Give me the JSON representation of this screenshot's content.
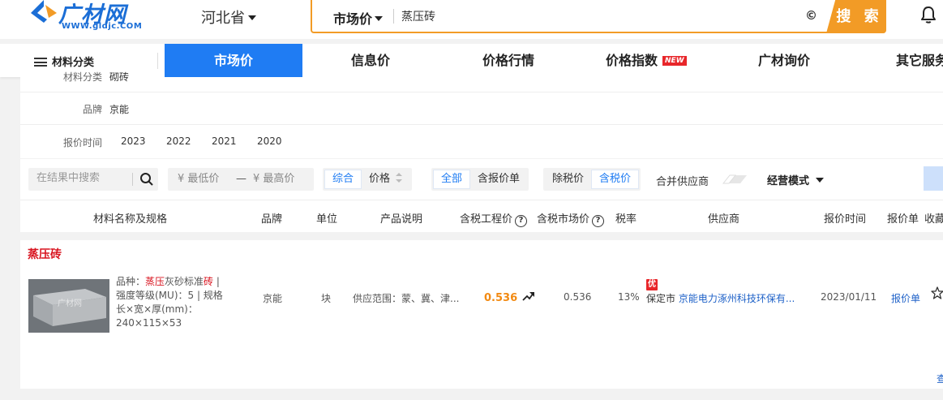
{
  "header": {
    "logo_text": "广材网",
    "logo_url": "WWW.gldjc.COM",
    "region": "河北省",
    "search_type": "市场价",
    "search_value": "蒸压砖",
    "clear_icon": "©",
    "search_button": "搜 索",
    "bell_icon": "bell-icon"
  },
  "nav": {
    "category": "材料分类",
    "tabs": [
      {
        "label": "市场价",
        "active": true
      },
      {
        "label": "信息价"
      },
      {
        "label": "价格行情"
      },
      {
        "label": "价格指数",
        "badge": "NEW"
      },
      {
        "label": "广材询价"
      },
      {
        "label": "其它服务"
      }
    ]
  },
  "filters": {
    "category_label": "材料分类",
    "category_value": "砌砖",
    "brand_label": "品牌",
    "brand_value": "京能",
    "time_label": "报价时间",
    "years": [
      "2023",
      "2022",
      "2021",
      "2020"
    ]
  },
  "toolbar": {
    "search_placeholder": "在结果中搜索",
    "min_price": "¥ 最低价",
    "dash": "—",
    "max_price": "¥ 最高价",
    "sort_options": [
      "综合",
      "价格"
    ],
    "scope_options": [
      "全部",
      "含报价单"
    ],
    "tax_options": [
      "除税价",
      "含税价"
    ],
    "merge_label": "合并供应商",
    "mode_label": "经营模式"
  },
  "table_headers": [
    "材料名称及规格",
    "品牌",
    "单位",
    "产品说明",
    "含税工程价",
    "含税市场价",
    "税率",
    "供应商",
    "报价时间",
    "报价单",
    "收藏"
  ],
  "product": {
    "title": "蒸压砖",
    "image_watermark": "广材网",
    "desc_variety_label": "品种：",
    "desc_variety_hl1": "蒸压",
    "desc_variety_mid": "灰砂标准",
    "desc_variety_hl2": "砖",
    "desc_rest": " | 强度等级(MU)：5 | 规格长×宽×厚(mm)：240×115×53",
    "brand": "京能",
    "unit": "块",
    "supply": "供应范围：蒙、冀、津...",
    "eng_price": "0.536",
    "market_price": "0.536",
    "tax_rate": "13%",
    "badge": "优",
    "city": "保定市",
    "supplier": "京能电力涿州科技环保有...",
    "date": "2023/01/11",
    "quote": "报价单",
    "more": "查"
  },
  "colors": {
    "brand_blue": "#1f7cf3",
    "orange": "#f29b26",
    "price_orange": "#f28a12",
    "red": "#d8131e"
  }
}
